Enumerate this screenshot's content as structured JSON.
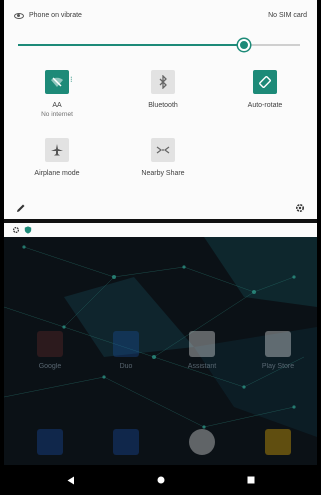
{
  "status": {
    "ringer_text": "Phone on vibrate",
    "sim_text": "No SIM card",
    "ringer_icon": "eye-icon"
  },
  "brightness": {
    "level": 0.8
  },
  "tiles": [
    {
      "label": "AA",
      "sub": "No internet",
      "icon": "wifi-off-icon",
      "active": true
    },
    {
      "label": "Bluetooth",
      "icon": "bluetooth-icon",
      "active": false
    },
    {
      "label": "Auto-rotate",
      "icon": "auto-rotate-icon",
      "active": true
    },
    {
      "label": "Airplane mode",
      "icon": "airplane-icon",
      "active": false
    },
    {
      "label": "Nearby Share",
      "icon": "nearby-share-icon",
      "active": false
    }
  ],
  "apps_row1": [
    {
      "label": "Google",
      "icon": "google-folder-icon",
      "color": "#6a2a2a"
    },
    {
      "label": "Duo",
      "icon": "duo-icon",
      "color": "#1b4fa0"
    },
    {
      "label": "Assistant",
      "icon": "assistant-icon",
      "color": "#ffffff"
    },
    {
      "label": "Play Store",
      "icon": "play-store-icon",
      "color": "#ffffff"
    }
  ],
  "apps_row2": [
    {
      "label": "",
      "icon": "phone-icon",
      "color": "#1a4fb0"
    },
    {
      "label": "",
      "icon": "messages-icon",
      "color": "#1a4fb0"
    },
    {
      "label": "",
      "icon": "chrome-icon",
      "color": "#ffffff"
    },
    {
      "label": "",
      "icon": "camera-icon",
      "color": "#ffc107"
    }
  ],
  "colors": {
    "accent": "#1d8a78",
    "panel": "#fbfbfb",
    "nav": "#000000"
  }
}
